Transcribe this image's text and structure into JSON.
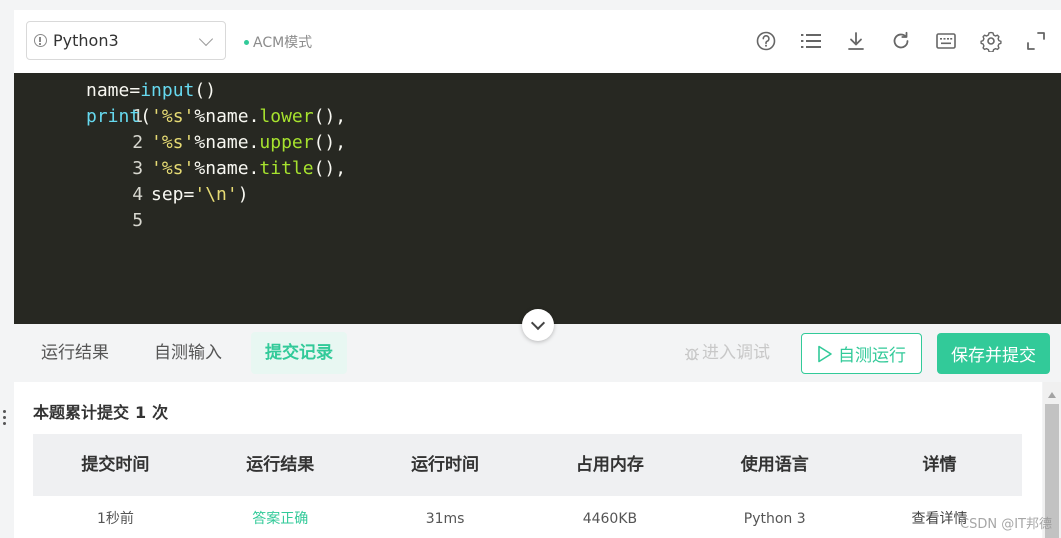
{
  "toolbar": {
    "language": "Python3",
    "mode": "ACM模式",
    "icons": [
      "help-icon",
      "list-icon",
      "download-icon",
      "refresh-icon",
      "keyboard-icon",
      "settings-icon",
      "fullscreen-icon"
    ]
  },
  "editor": {
    "lines": [
      {
        "n": "1"
      },
      {
        "n": "2"
      },
      {
        "n": "3"
      },
      {
        "n": "4"
      },
      {
        "n": "5"
      }
    ],
    "tokens": {
      "l1_name": "name=",
      "l1_input": "input",
      "l1_paren": "()",
      "l2_print": "print",
      "l2_open": "(",
      "l2_str": "'%s'",
      "l2_mid": "%name.",
      "l2_method": "lower",
      "l2_tail": "(),",
      "l3_str": "'%s'",
      "l3_mid": "%name.",
      "l3_method": "upper",
      "l3_tail": "(),",
      "l4_str": "'%s'",
      "l4_mid": "%name.",
      "l4_method": "title",
      "l4_tail": "(),",
      "l5_sep": "sep=",
      "l5_str": "'\\n'",
      "l5_close": ")"
    }
  },
  "tabs": {
    "result": "运行结果",
    "custom_input": "自测输入",
    "records": "提交记录",
    "debug": "进入调试",
    "run": "自测运行",
    "submit": "保存并提交"
  },
  "records": {
    "summary_prefix": "本题累计提交",
    "summary_count": "1",
    "summary_suffix": "次",
    "headers": [
      "提交时间",
      "运行结果",
      "运行时间",
      "占用内存",
      "使用语言",
      "详情"
    ],
    "rows": [
      [
        "1秒前",
        "答案正确",
        "31ms",
        "4460KB",
        "Python 3",
        "查看详情"
      ]
    ]
  },
  "watermark": "CSDN @IT邦德",
  "colors": {
    "accent": "#32ca99",
    "editor_bg": "#272822"
  }
}
